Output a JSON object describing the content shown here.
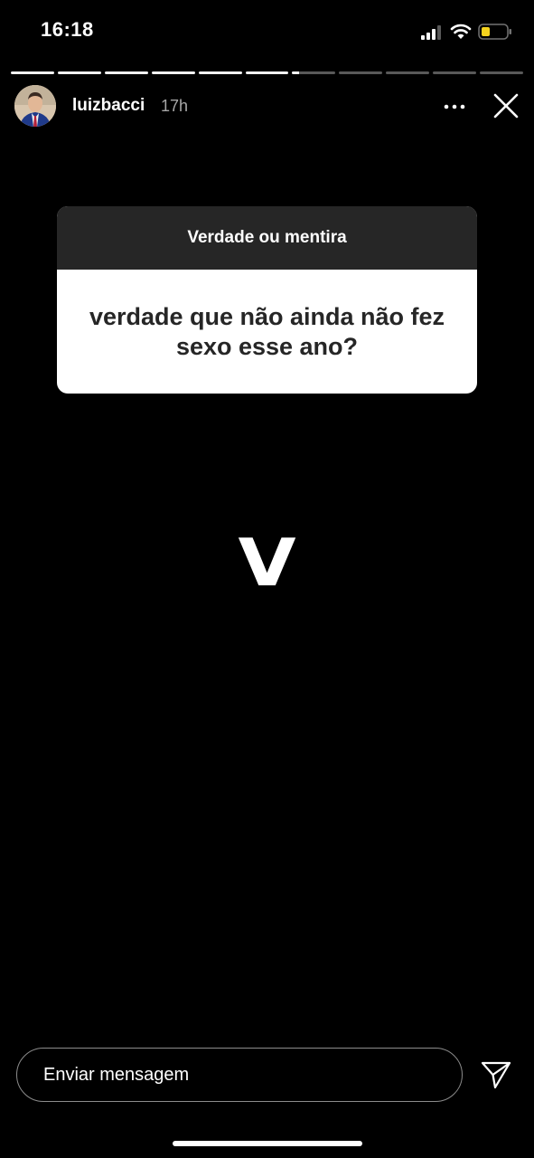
{
  "status_bar": {
    "time": "16:18",
    "icons": [
      "cellular-signal-icon",
      "wifi-icon",
      "battery-icon"
    ],
    "battery_color": "#f5d31e"
  },
  "story": {
    "segments_total": 11,
    "segments_completed": 6,
    "current_segment_progress": 0.15,
    "username": "luizbacci",
    "time_ago": "17h",
    "avatar_icon": "profile-photo-avatar",
    "more_icon": "more-options-icon",
    "close_icon": "close-icon"
  },
  "question_card": {
    "title": "Verdade ou mentira",
    "question": "verdade que não ainda não fez sexo esse ano?",
    "header_color": "#262626",
    "body_color": "#ffffff"
  },
  "answer": {
    "text": "V"
  },
  "message_bar": {
    "placeholder": "Enviar mensagem",
    "send_icon": "send-icon"
  }
}
